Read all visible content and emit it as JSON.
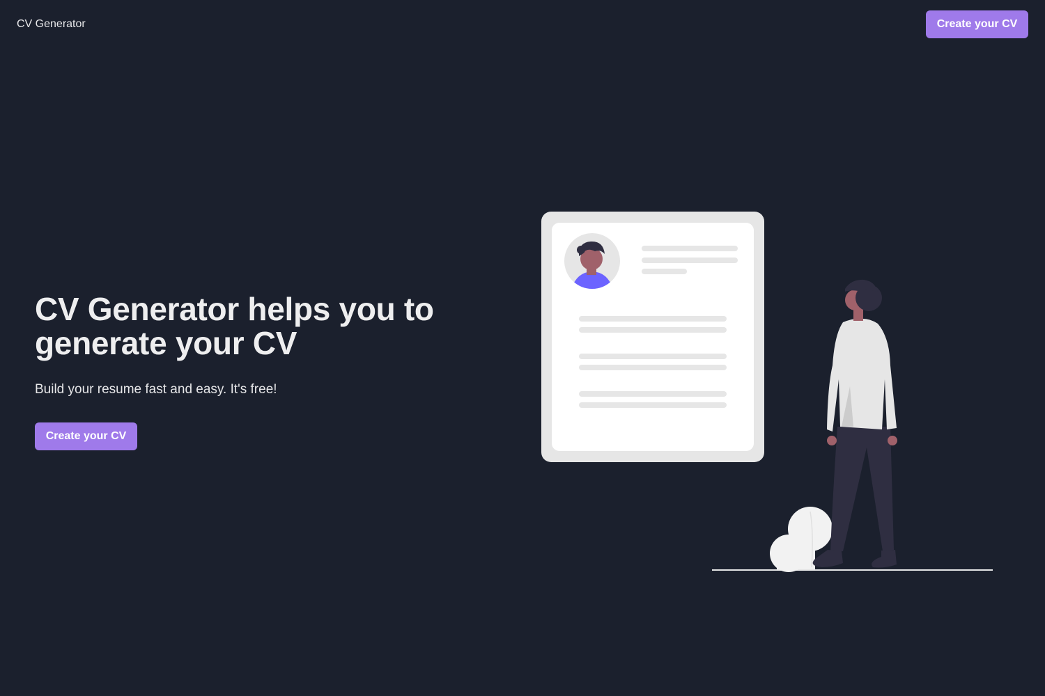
{
  "navbar": {
    "brand": "CV Generator",
    "cta_label": "Create your CV"
  },
  "hero": {
    "title": "CV Generator helps you to generate your CV",
    "subtitle": "Build your resume fast and easy. It's free!",
    "cta_label": "Create your CV"
  },
  "colors": {
    "background": "#1b202d",
    "accent": "#9f7aea",
    "illustration_accent": "#6c63ff"
  }
}
